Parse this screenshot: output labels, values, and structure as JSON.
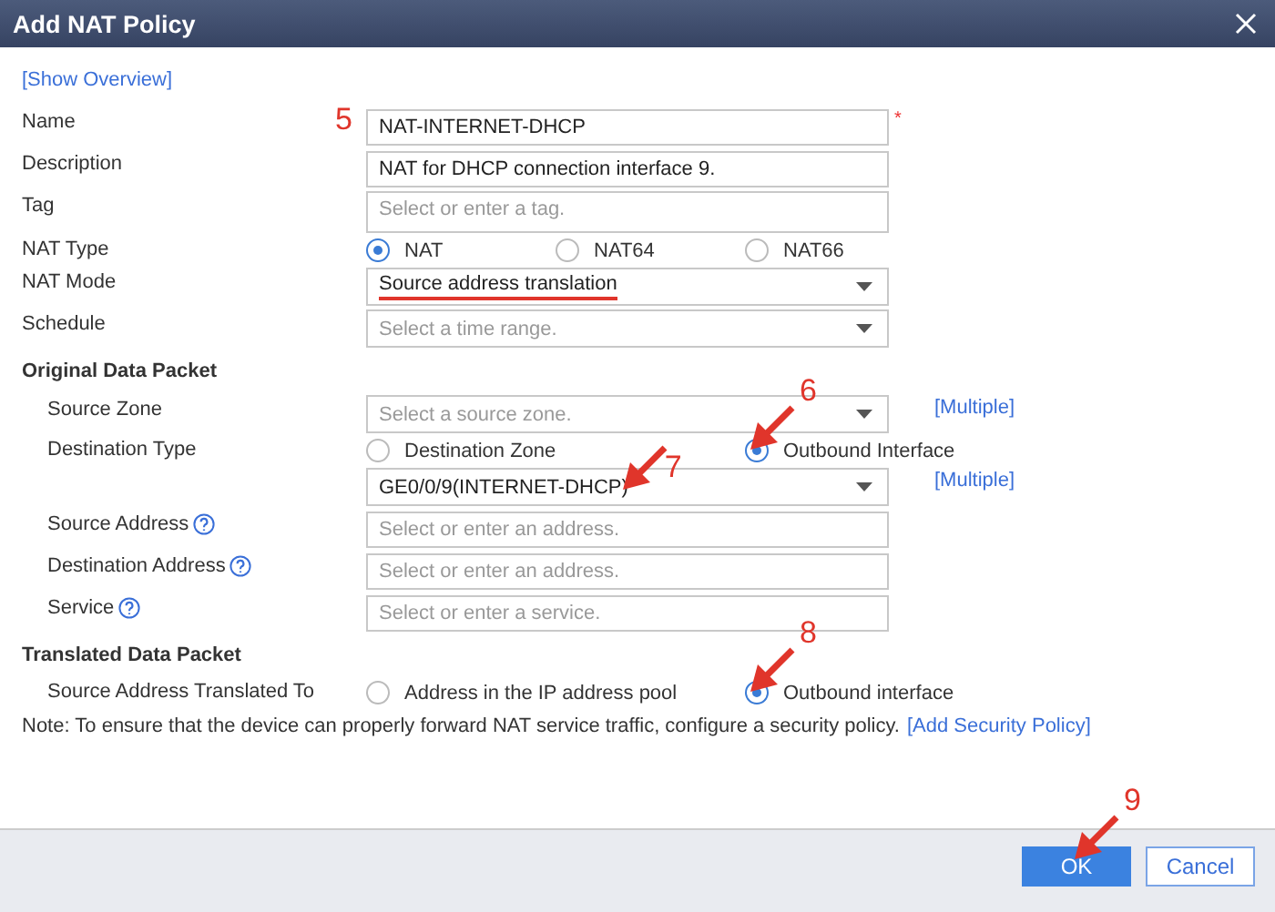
{
  "window": {
    "title": "Add NAT Policy"
  },
  "overview_link": "[Show Overview]",
  "fields": [
    {
      "kind": "text",
      "label": "Name",
      "value": "NAT-INTERNET-DHCP",
      "required": true,
      "required_mark": "*",
      "marker": {
        "number": "5",
        "arrow": false
      }
    },
    {
      "kind": "text",
      "label": "Description",
      "value": "NAT for DHCP connection interface 9."
    },
    {
      "kind": "tag",
      "label": "Tag",
      "placeholder": "Select or enter a tag."
    },
    {
      "kind": "radio",
      "label": "NAT Type",
      "options": [
        {
          "label": "NAT",
          "selected": true
        },
        {
          "label": "NAT64",
          "selected": false
        },
        {
          "label": "NAT66",
          "selected": false
        }
      ]
    },
    {
      "kind": "select",
      "label": "NAT Mode",
      "value": "Source address translation",
      "underlined": true
    },
    {
      "kind": "select",
      "label": "Schedule",
      "placeholder": "Select a time range."
    }
  ],
  "sections": [
    {
      "title": "Original Data Packet",
      "fields": [
        {
          "kind": "select",
          "label": "Source Zone",
          "placeholder": "Select a source zone.",
          "link": "[Multiple]"
        },
        {
          "kind": "radio",
          "label": "Destination Type",
          "options": [
            {
              "label": "Destination Zone",
              "selected": false
            },
            {
              "label": "Outbound Interface",
              "selected": true,
              "marker": {
                "number": "6",
                "arrow": true
              }
            }
          ]
        },
        {
          "kind": "select",
          "value": "GE0/0/9(INTERNET-DHCP)",
          "link": "[Multiple]",
          "marker": {
            "number": "7",
            "arrow": true
          }
        },
        {
          "kind": "text",
          "label": "Source Address",
          "help": true,
          "placeholder": "Select or enter an address."
        },
        {
          "kind": "text",
          "label": "Destination Address",
          "help": true,
          "placeholder": "Select or enter an address."
        },
        {
          "kind": "text",
          "label": "Service",
          "help": true,
          "placeholder": "Select or enter a service."
        }
      ]
    },
    {
      "title": "Translated Data Packet",
      "fields": [
        {
          "kind": "radio",
          "label": "Source Address Translated To",
          "options": [
            {
              "label": "Address in the IP address pool",
              "selected": false
            },
            {
              "label": "Outbound interface",
              "selected": true,
              "marker": {
                "number": "8",
                "arrow": true
              }
            }
          ]
        }
      ]
    }
  ],
  "note": {
    "text": "Note: To ensure that the device can properly forward NAT service traffic, configure a security policy.",
    "link": "[Add Security Policy]"
  },
  "buttons": [
    {
      "label": "OK",
      "kind": "primary",
      "marker": {
        "number": "9",
        "arrow": true
      }
    },
    {
      "label": "Cancel",
      "kind": "secondary"
    }
  ]
}
